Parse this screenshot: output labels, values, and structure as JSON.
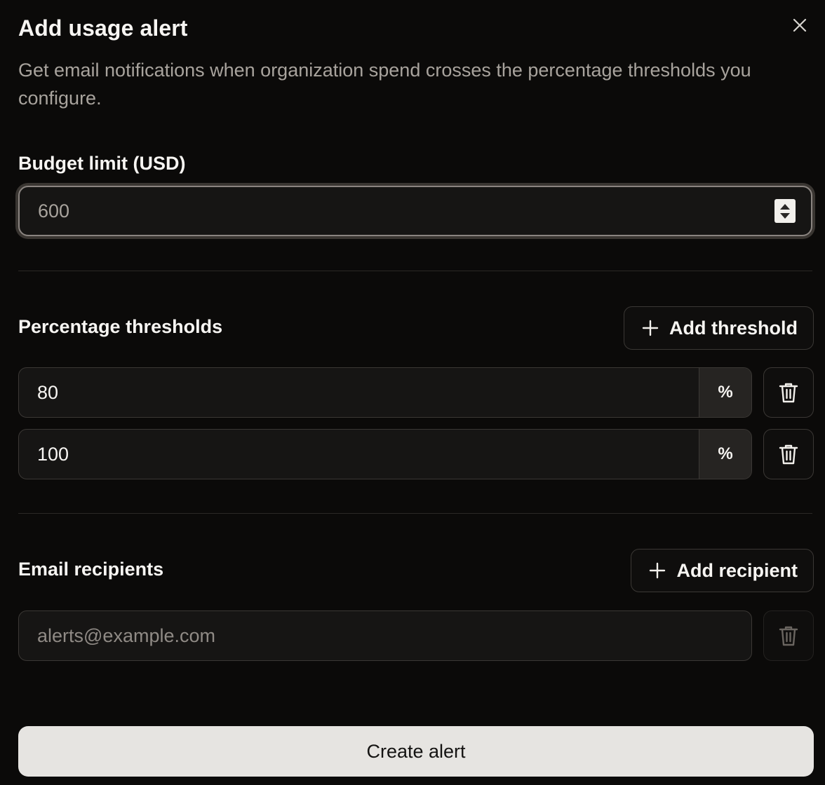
{
  "dialog": {
    "title": "Add usage alert",
    "description": "Get email notifications when organization spend crosses the percentage thresholds you configure."
  },
  "budget": {
    "label": "Budget limit (USD)",
    "value": "600"
  },
  "thresholds": {
    "label": "Percentage thresholds",
    "add_label": "Add threshold",
    "suffix": "%",
    "items": [
      {
        "value": "80"
      },
      {
        "value": "100"
      }
    ]
  },
  "recipients": {
    "label": "Email recipients",
    "add_label": "Add recipient",
    "placeholder": "alerts@example.com"
  },
  "actions": {
    "submit_label": "Create alert"
  },
  "colors": {
    "background": "#0b0a09",
    "primary_button": "#e6e4e1"
  }
}
